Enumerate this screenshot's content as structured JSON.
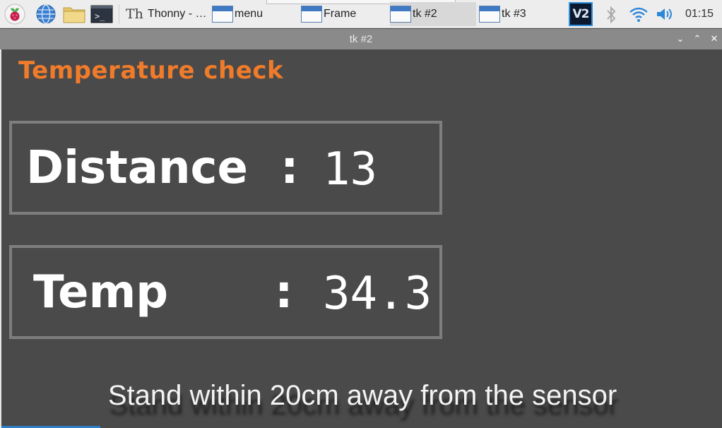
{
  "taskbar": {
    "launchers": [
      "raspberry-menu-icon",
      "web-browser-icon",
      "file-manager-icon",
      "terminal-icon"
    ],
    "tasks": [
      {
        "label": "Thonny  -  …",
        "icon": "thonny-icon",
        "active": false
      },
      {
        "label": "menu",
        "icon": "window-icon",
        "active": false
      },
      {
        "label": "Frame",
        "icon": "window-icon",
        "active": false
      },
      {
        "label": "tk #2",
        "icon": "window-icon",
        "active": true
      },
      {
        "label": "tk #3",
        "icon": "window-icon",
        "active": false
      }
    ],
    "vnc_label": "V2",
    "clock": "01:15"
  },
  "window": {
    "title": "tk #2",
    "controls": {
      "minimize": "⌄",
      "maximize": "⌃",
      "close": "✕"
    }
  },
  "app": {
    "heading": "Temperature check",
    "distance": {
      "label": "Distance",
      "colon": ":",
      "value": "13"
    },
    "temp": {
      "label": "Temp",
      "colon": ":",
      "value": "34.3"
    },
    "instruction": "Stand within 20cm away from the sensor"
  },
  "colors": {
    "heading": "#f07b2a",
    "background": "#4a4a4a",
    "box_border": "#7e7e7e",
    "titlebar": "#8a8a8a",
    "taskbar": "#ededed"
  }
}
